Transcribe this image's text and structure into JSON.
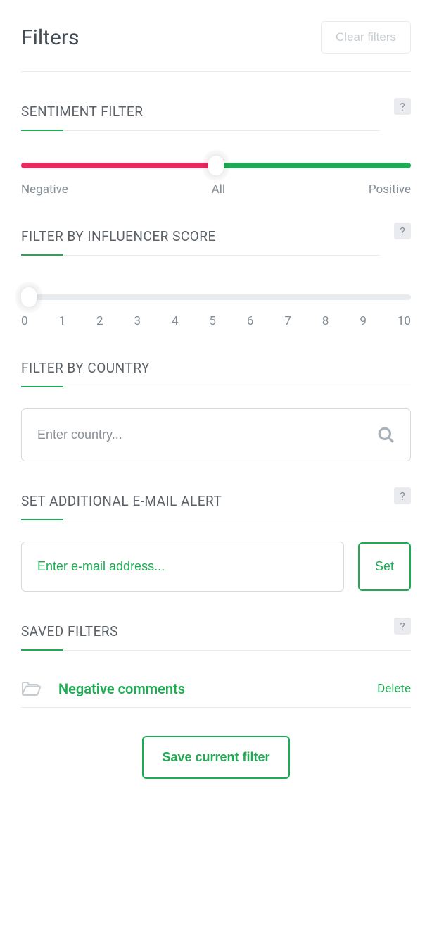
{
  "header": {
    "title": "Filters",
    "clear_label": "Clear filters"
  },
  "sentiment": {
    "title": "SENTIMENT FILTER",
    "help": "?",
    "labels": {
      "negative": "Negative",
      "all": "All",
      "positive": "Positive"
    }
  },
  "influencer": {
    "title": "FILTER BY INFLUENCER SCORE",
    "help": "?",
    "ticks": [
      "0",
      "1",
      "2",
      "3",
      "4",
      "5",
      "6",
      "7",
      "8",
      "9",
      "10"
    ]
  },
  "country": {
    "title": "FILTER BY COUNTRY",
    "placeholder": "Enter country..."
  },
  "email_alert": {
    "title": "SET ADDITIONAL E-MAIL ALERT",
    "help": "?",
    "placeholder": "Enter e-mail address...",
    "set_label": "Set"
  },
  "saved": {
    "title": "SAVED FILTERS",
    "help": "?",
    "items": [
      {
        "name": "Negative comments",
        "delete_label": "Delete"
      }
    ]
  },
  "save_button_label": "Save current filter"
}
